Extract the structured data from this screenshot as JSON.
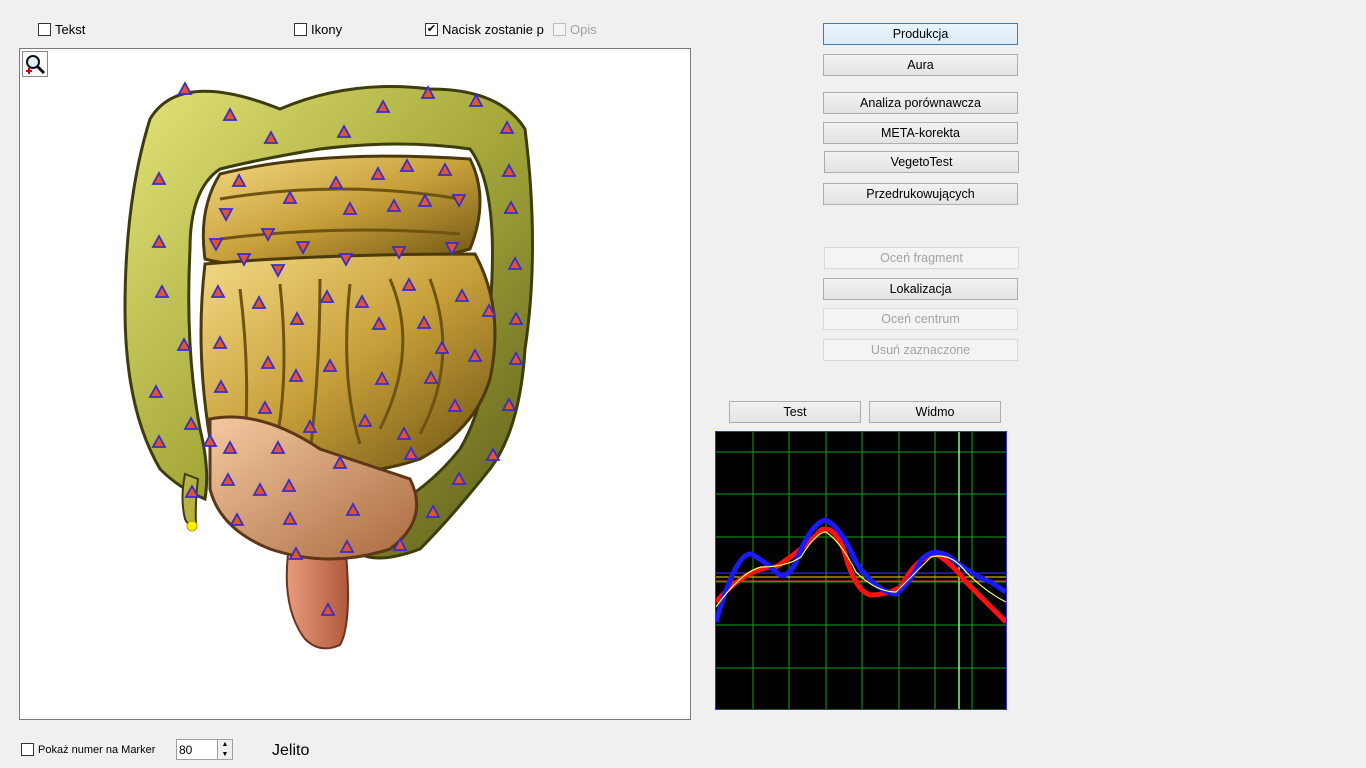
{
  "top_checks": {
    "tekst": {
      "label": "Tekst",
      "checked": false
    },
    "ikony": {
      "label": "Ikony",
      "checked": false
    },
    "nacisk": {
      "label": "Nacisk zostanie p",
      "checked": true
    },
    "opis": {
      "label": "Opis",
      "checked": false,
      "disabled": true
    }
  },
  "actions": {
    "produkcja": "Produkcja",
    "aura": "Aura",
    "analiza": "Analiza porównawcza",
    "meta": "META-korekta",
    "vegeto": "VegetoTest",
    "przedruk": "Przedrukowujących",
    "ocen_fragment": "Oceń fragment",
    "lokalizacja": "Lokalizacja",
    "ocen_centrum": "Oceń centrum",
    "usun": "Usuń zaznaczone",
    "test": "Test",
    "widmo": "Widmo"
  },
  "bottom": {
    "pokaz_label": "Pokaż numer na Marker",
    "pokaz_checked": false,
    "marker_value": "80",
    "organ_name": "Jelito"
  },
  "icons": {
    "zoom": "magnifier-plus-icon",
    "check": "checkmark-icon",
    "spin_up": "arrow-up-icon",
    "spin_down": "arrow-down-icon"
  },
  "colors": {
    "marker_fill": "#e0562a",
    "marker_outline": "#3a2dd0",
    "graph_bg": "#000000",
    "grid": "#18a018",
    "line_red": "#ff1010",
    "line_blue": "#1a1aff",
    "line_yellow": "#ffff60"
  }
}
